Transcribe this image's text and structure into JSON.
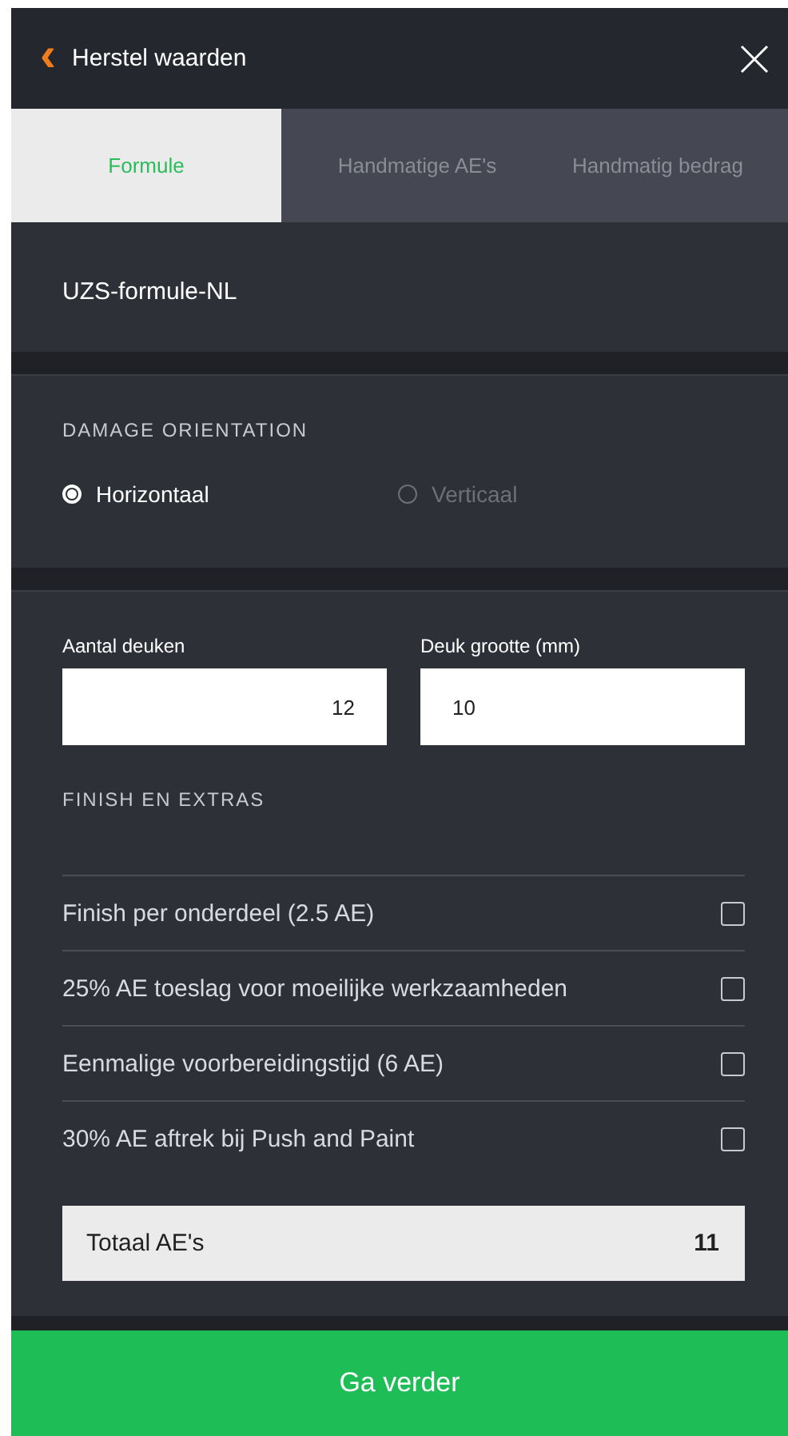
{
  "header": {
    "back_icon": "‹",
    "title": "Herstel waarden"
  },
  "tabs": [
    {
      "label": "Formule",
      "selected": true
    },
    {
      "label": "Handmatige AE's",
      "selected": false
    },
    {
      "label": "Handmatig bedrag",
      "selected": false
    }
  ],
  "formula_name": "UZS-formule-NL",
  "damage_orientation": {
    "heading": "DAMAGE ORIENTATION",
    "options": [
      {
        "label": "Horizontaal",
        "selected": true
      },
      {
        "label": "Verticaal",
        "selected": false
      }
    ]
  },
  "fields": [
    {
      "label": "Aantal deuken",
      "value": "12",
      "kind": "numeric"
    },
    {
      "label": "Deuk grootte (mm)",
      "value": "10",
      "kind": "text"
    }
  ],
  "extras": {
    "heading": "FINISH EN EXTRAS",
    "items": [
      {
        "label": "Finish per onderdeel (2.5 AE)",
        "checked": false
      },
      {
        "label": "25% AE toeslag voor moeilijke werkzaamheden",
        "checked": false
      },
      {
        "label": "Eenmalige voorbereidingstijd (6 AE)",
        "checked": false
      },
      {
        "label": "30% AE aftrek bij Push and Paint",
        "checked": false
      }
    ]
  },
  "total": {
    "label": "Totaal AE's",
    "value": "11"
  },
  "continue_button": "Ga verder"
}
